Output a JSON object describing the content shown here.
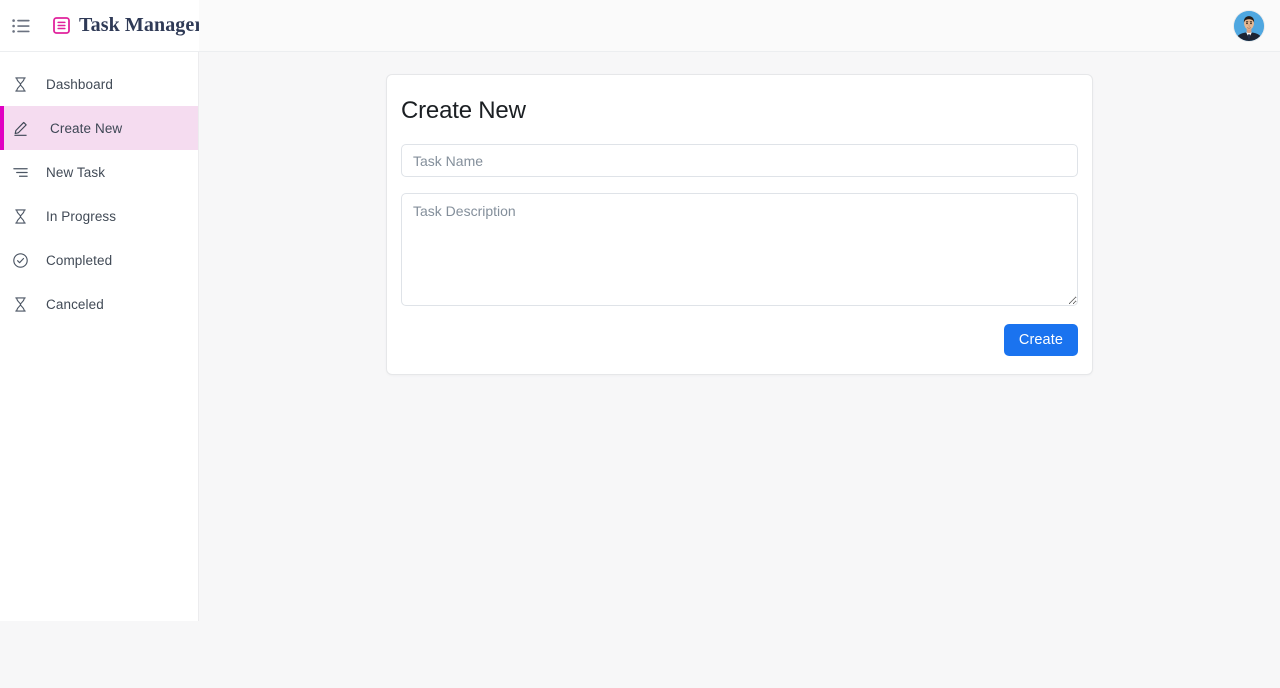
{
  "header": {
    "menu_icon": "list-menu-icon",
    "brand_icon": "document-list-icon",
    "brand_title": "Task Manager",
    "avatar_icon": "user-avatar",
    "accent_color": "#e0229c",
    "brand_text_color": "#2f3a56"
  },
  "sidebar": {
    "active_bg": "#f5dcf0",
    "active_border": "#e000c2",
    "items": [
      {
        "label": "Dashboard",
        "icon": "hourglass-icon",
        "active": false
      },
      {
        "label": "Create New",
        "icon": "pencil-edit-icon",
        "active": true
      },
      {
        "label": "New Task",
        "icon": "align-lines-icon",
        "active": false
      },
      {
        "label": "In Progress",
        "icon": "hourglass-icon",
        "active": false
      },
      {
        "label": "Completed",
        "icon": "check-circle-icon",
        "active": false
      },
      {
        "label": "Canceled",
        "icon": "hourglass-icon",
        "active": false
      }
    ]
  },
  "main": {
    "card": {
      "title": "Create New",
      "task_name": {
        "placeholder": "Task Name",
        "value": ""
      },
      "task_description": {
        "placeholder": "Task Description",
        "value": ""
      },
      "submit_label": "Create",
      "submit_color": "#1a73ef"
    }
  },
  "colors": {
    "page_background": "#f7f7f8",
    "panel_background": "#ffffff",
    "border": "#e6e7e9",
    "text": "#414a56",
    "placeholder": "#848f9b"
  }
}
